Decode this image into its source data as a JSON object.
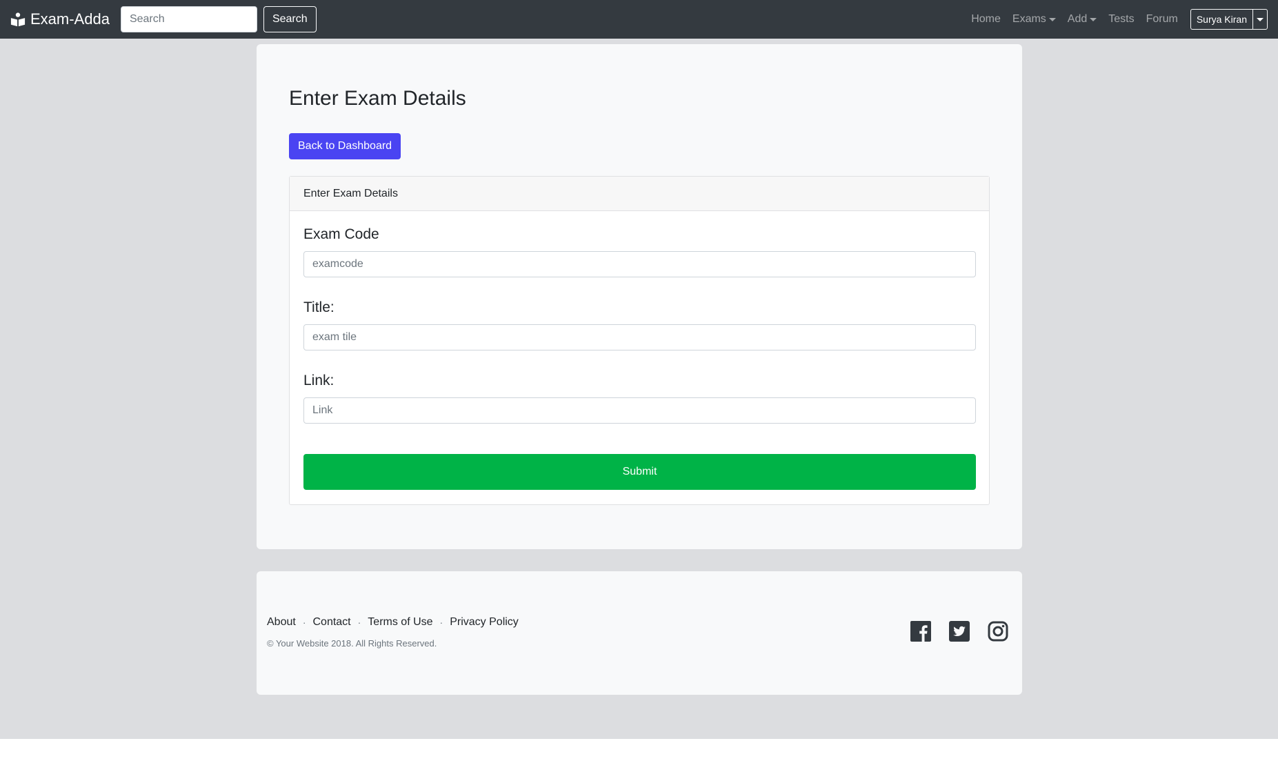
{
  "navbar": {
    "brand": "Exam-Adda",
    "search_placeholder": "Search",
    "search_button": "Search",
    "links": {
      "home": "Home",
      "exams": "Exams",
      "add": "Add",
      "tests": "Tests",
      "forum": "Forum"
    },
    "user": "Surya Kiran"
  },
  "main": {
    "title": "Enter Exam Details",
    "back_button": "Back to Dashboard",
    "form": {
      "header": "Enter Exam Details",
      "exam_code_label": "Exam Code",
      "exam_code_placeholder": "examcode",
      "title_label": "Title:",
      "title_placeholder": "exam tile",
      "link_label": "Link:",
      "link_placeholder": "Link",
      "submit": "Submit"
    }
  },
  "footer": {
    "about": "About",
    "contact": "Contact",
    "terms": "Terms of Use",
    "privacy": "Privacy Policy",
    "separator": "·",
    "copyright": "© Your Website 2018. All Rights Reserved.",
    "social_icons": [
      "facebook-icon",
      "twitter-icon",
      "instagram-icon"
    ]
  },
  "colors": {
    "navbar": "#343a40",
    "primary_button": "#4a44f2",
    "submit_button": "#00b347",
    "page_background": "#dcdde0"
  }
}
